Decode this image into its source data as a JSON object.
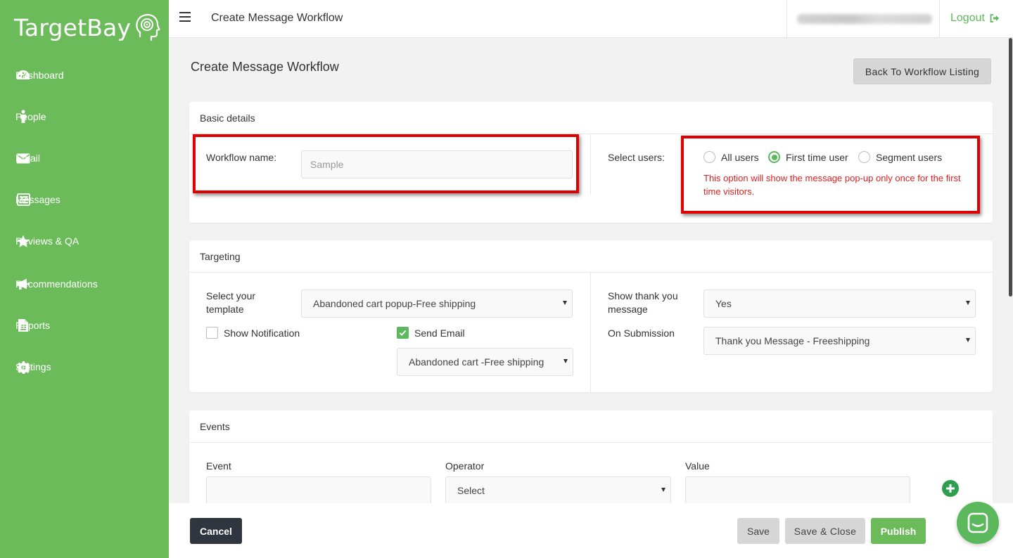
{
  "app": {
    "logo_text": "TargetBay"
  },
  "sidebar": {
    "items": [
      {
        "label": "Dashboard",
        "icon": "dashboard-icon"
      },
      {
        "label": "People",
        "icon": "person-icon"
      },
      {
        "label": "Email",
        "icon": "envelope-icon"
      },
      {
        "label": "Messages",
        "icon": "messages-icon"
      },
      {
        "label": "Reviews & QA",
        "icon": "star-icon"
      },
      {
        "label": "Recommendations",
        "icon": "megaphone-icon"
      },
      {
        "label": "Reports",
        "icon": "document-icon"
      },
      {
        "label": "Settings",
        "icon": "gear-icon"
      }
    ]
  },
  "header": {
    "title": "Create Message Workflow",
    "logout_label": "Logout"
  },
  "page": {
    "title": "Create Message Workflow",
    "back_button": "Back To Workflow Listing"
  },
  "basic": {
    "heading": "Basic details",
    "workflow_name_label": "Workflow name:",
    "workflow_name_placeholder": "Sample",
    "select_users_label": "Select users:",
    "options": [
      "All users",
      "First time user",
      "Segment users"
    ],
    "selected_option": "First time user",
    "note": "This option will show the message pop-up only once for the first time visitors."
  },
  "targeting": {
    "heading": "Targeting",
    "template_label": "Select your template",
    "template_value": "Abandoned cart popup-Free shipping",
    "show_notification_label": "Show Notification",
    "show_notification_checked": false,
    "send_email_label": "Send Email",
    "send_email_checked": true,
    "email_template_value": "Abandoned cart -Free shipping",
    "thank_you_label": "Show thank you message",
    "thank_you_value": "Yes",
    "on_submission_label": "On Submission",
    "on_submission_value": "Thank you Message - Freeshipping"
  },
  "events": {
    "heading": "Events",
    "event_label": "Event",
    "operator_label": "Operator",
    "operator_value": "Select",
    "value_label": "Value"
  },
  "footer": {
    "cancel": "Cancel",
    "save": "Save",
    "save_close": "Save & Close",
    "publish": "Publish"
  },
  "colors": {
    "brand_green": "#6cbb5a",
    "dark_button": "#2f3640",
    "note_red": "#e02020",
    "highlight_red": "#e00000"
  }
}
